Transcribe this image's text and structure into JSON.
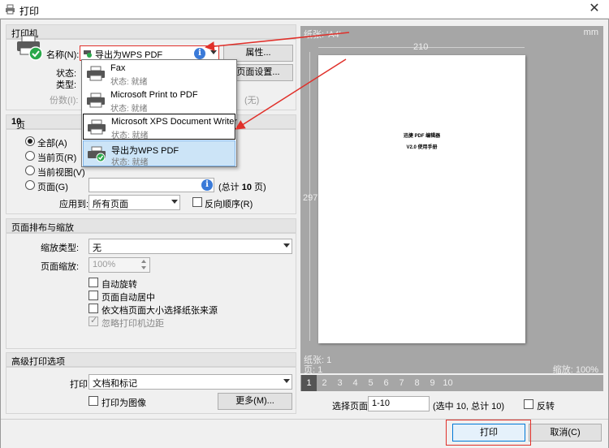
{
  "window": {
    "title": "打印",
    "close_glyph": "✕"
  },
  "printer": {
    "section_title": "打印机",
    "name_label": "名称(N):",
    "name_value": "导出为WPS PDF",
    "properties_button": "属性...",
    "status_label": "状态:",
    "type_label": "类型:",
    "copies_label": "份数(I):",
    "page_setup_button": "页面设置...",
    "collate_hint": "(无)",
    "dropdown": [
      {
        "name": "Fax",
        "status": "状态: 就绪"
      },
      {
        "name": "Microsoft Print to PDF",
        "status": "状态: 就绪"
      },
      {
        "name": "Microsoft XPS Document Writer",
        "status": "状态: 就绪"
      },
      {
        "name": "导出为WPS PDF",
        "status": "状态: 就绪"
      }
    ]
  },
  "range": {
    "section_title_prefix": "页面范围: 选中",
    "section_title_count": "10",
    "all": "全部(A)",
    "current_page": "当前页(R)",
    "current_view": "当前视图(V)",
    "pages": "页面(G)",
    "pages_value": "",
    "total_prefix": "(总计",
    "total_count": "10",
    "total_suffix": "页)",
    "apply_to_label": "应用到:",
    "apply_to_value": "所有页面",
    "reverse_label": "反向顺序(R)"
  },
  "layout": {
    "section_title": "页面排布与缩放",
    "scale_type_label": "缩放类型:",
    "scale_type_value": "无",
    "page_scale_label": "页面缩放:",
    "page_scale_value": "100%",
    "auto_rotate": "自动旋转",
    "auto_center": "页面自动居中",
    "choose_paper_source": "依文档页面大小选择纸张来源",
    "ignore_margins": "忽略打印机边距"
  },
  "advanced": {
    "section_title": "高级打印选项",
    "print_label": "打印",
    "print_value": "文档和标记",
    "print_as_image": "打印为图像",
    "more_button": "更多(M)..."
  },
  "preview": {
    "paper_label": "纸张: 'A4'",
    "unit": "mm",
    "width": "210",
    "height": "297",
    "page_line1": "迅捷 PDF 编辑器",
    "page_line2": "V2.0 使用手册",
    "paper_count": "纸张: 1",
    "page_count": "页: 1",
    "zoom": "缩放: 100%",
    "pages": [
      "1",
      "2",
      "3",
      "4",
      "5",
      "6",
      "7",
      "8",
      "9",
      "10"
    ],
    "current_page": "1",
    "select_pages_label": "选择页面:",
    "select_pages_value": "1-10",
    "select_pages_info": "(选中 10, 总计 10)",
    "reverse_label": "反转"
  },
  "buttons": {
    "print": "打印",
    "cancel": "取消(C)"
  },
  "colors": {
    "annotation_red": "#e0302a",
    "selected_item": "#cce4f7",
    "preview_bg": "#a6a6a6"
  }
}
